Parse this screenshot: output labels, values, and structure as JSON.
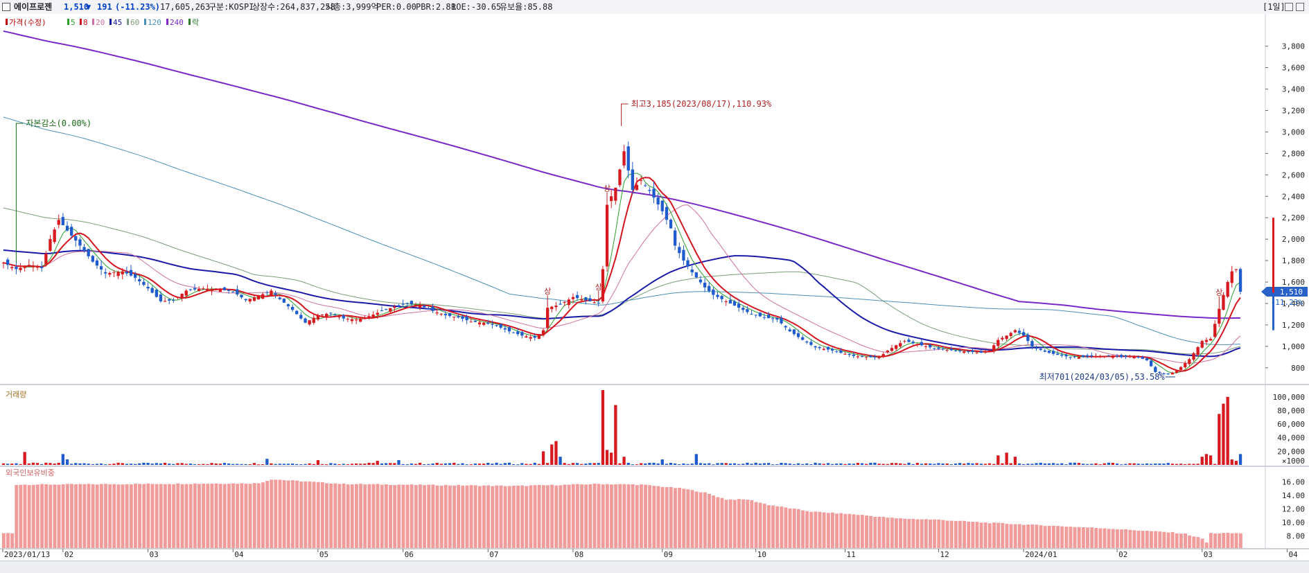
{
  "header": {
    "name": "에이프로젠",
    "price": "1,510",
    "change_arrow": "▼",
    "change": "191",
    "change_pct": "(-11.23%)",
    "volume": "17,605,263",
    "market": "구분:KOSPI",
    "listed": "상장수:264,837,258",
    "mcap": "시총:3,999억",
    "per": "PER:0.00",
    "pbr": "PBR:2.81",
    "roe": "ROE:-30.65",
    "float": "유보율:85.88",
    "period": "[1일]"
  },
  "legend": {
    "items": [
      {
        "label": "가격(수정)",
        "color": "#c00000"
      },
      {
        "label": "5",
        "color": "#2aa02a"
      },
      {
        "label": "8",
        "color": "#d4141e"
      },
      {
        "label": "20",
        "color": "#d070a0"
      },
      {
        "label": "45",
        "color": "#1a1aa8"
      },
      {
        "label": "60",
        "color": "#7a9e7a"
      },
      {
        "label": "120",
        "color": "#4a90b8"
      },
      {
        "label": "240",
        "color": "#7a28c8"
      },
      {
        "label": "락",
        "color": "#2a7a2a"
      }
    ],
    "volume_label": "거래량",
    "foreign_label": "외국인보유비중"
  },
  "annotations": {
    "capital_reduction": "자본감소(0.00%)",
    "high": "최고3,185(2023/08/17),110.93%",
    "low": "최저701(2024/03/05),53.58%",
    "limit_up": "상"
  },
  "current": {
    "price_label": "1,510",
    "pct_label": "-11.23%"
  },
  "chart_data": {
    "type": "candlestick",
    "x_labels": [
      "2023/01/13",
      "02",
      "03",
      "04",
      "05",
      "06",
      "07",
      "08",
      "09",
      "10",
      "11",
      "12",
      "2024/01",
      "02",
      "03",
      "04"
    ],
    "price_axis": {
      "ticks": [
        800,
        1000,
        1200,
        1400,
        1600,
        1800,
        2000,
        2200,
        2400,
        2600,
        2800,
        3000,
        3200,
        3400,
        3600,
        3800
      ],
      "ylim": [
        650,
        4050
      ]
    },
    "volume_axis": {
      "ticks": [
        "100,000",
        "80,000",
        "60,000",
        "40,000",
        "20,000"
      ],
      "unit": "×1000",
      "ylim": [
        0,
        110000
      ]
    },
    "foreign_axis": {
      "ticks": [
        "16.00",
        "14.00",
        "12.00",
        "10.00",
        "8.00"
      ],
      "ylim": [
        6.2,
        17.6
      ]
    },
    "price_anchors": [
      [
        0,
        1780
      ],
      [
        3,
        1720
      ],
      [
        6,
        1760
      ],
      [
        9,
        1730
      ],
      [
        11,
        2000
      ],
      [
        13,
        2180
      ],
      [
        15,
        2080
      ],
      [
        18,
        1940
      ],
      [
        21,
        1790
      ],
      [
        24,
        1680
      ],
      [
        28,
        1700
      ],
      [
        31,
        1640
      ],
      [
        34,
        1540
      ],
      [
        37,
        1420
      ],
      [
        40,
        1430
      ],
      [
        43,
        1520
      ],
      [
        47,
        1540
      ],
      [
        51,
        1530
      ],
      [
        54,
        1510
      ],
      [
        57,
        1430
      ],
      [
        60,
        1470
      ],
      [
        63,
        1520
      ],
      [
        65,
        1440
      ],
      [
        68,
        1340
      ],
      [
        71,
        1220
      ],
      [
        74,
        1290
      ],
      [
        77,
        1310
      ],
      [
        80,
        1260
      ],
      [
        83,
        1250
      ],
      [
        86,
        1280
      ],
      [
        89,
        1330
      ],
      [
        92,
        1370
      ],
      [
        95,
        1400
      ],
      [
        98,
        1380
      ],
      [
        101,
        1330
      ],
      [
        104,
        1290
      ],
      [
        107,
        1270
      ],
      [
        110,
        1230
      ],
      [
        113,
        1220
      ],
      [
        116,
        1190
      ],
      [
        119,
        1140
      ],
      [
        122,
        1100
      ],
      [
        125,
        1080
      ],
      [
        127,
        1150
      ],
      [
        128,
        1360
      ],
      [
        131,
        1390
      ],
      [
        134,
        1460
      ],
      [
        137,
        1430
      ],
      [
        140,
        1400
      ],
      [
        141,
        1720
      ],
      [
        142,
        2320
      ],
      [
        144,
        2480
      ],
      [
        146,
        2820
      ],
      [
        148,
        2460
      ],
      [
        150,
        2550
      ],
      [
        152,
        2450
      ],
      [
        155,
        2260
      ],
      [
        157,
        2100
      ],
      [
        158,
        1940
      ],
      [
        160,
        1800
      ],
      [
        162,
        1690
      ],
      [
        165,
        1550
      ],
      [
        167,
        1480
      ],
      [
        170,
        1420
      ],
      [
        173,
        1360
      ],
      [
        176,
        1300
      ],
      [
        179,
        1270
      ],
      [
        182,
        1250
      ],
      [
        185,
        1140
      ],
      [
        188,
        1060
      ],
      [
        191,
        990
      ],
      [
        194,
        970
      ],
      [
        197,
        940
      ],
      [
        200,
        910
      ],
      [
        203,
        900
      ],
      [
        206,
        895
      ],
      [
        208,
        960
      ],
      [
        210,
        1010
      ],
      [
        212,
        1050
      ],
      [
        215,
        1020
      ],
      [
        218,
        990
      ],
      [
        221,
        970
      ],
      [
        224,
        960
      ],
      [
        227,
        950
      ],
      [
        230,
        940
      ],
      [
        232,
        960
      ],
      [
        234,
        1060
      ],
      [
        236,
        1100
      ],
      [
        238,
        1150
      ],
      [
        240,
        1100
      ],
      [
        242,
        1000
      ],
      [
        245,
        950
      ],
      [
        248,
        920
      ],
      [
        251,
        900
      ],
      [
        254,
        900
      ],
      [
        257,
        910
      ],
      [
        260,
        910
      ],
      [
        263,
        900
      ],
      [
        266,
        910
      ],
      [
        269,
        870
      ],
      [
        271,
        760
      ],
      [
        274,
        740
      ],
      [
        276,
        770
      ],
      [
        279,
        880
      ],
      [
        282,
        1050
      ],
      [
        284,
        1070
      ],
      [
        286,
        1350
      ],
      [
        287,
        1480
      ],
      [
        288,
        1600
      ],
      [
        289,
        1700
      ],
      [
        290,
        1720
      ],
      [
        291,
        1510
      ]
    ],
    "volume_spikes": [
      [
        5,
        19
      ],
      [
        14,
        16
      ],
      [
        15,
        8
      ],
      [
        62,
        9
      ],
      [
        74,
        7
      ],
      [
        88,
        6
      ],
      [
        93,
        7
      ],
      [
        127,
        20
      ],
      [
        129,
        30
      ],
      [
        130,
        35
      ],
      [
        131,
        12
      ],
      [
        141,
        110
      ],
      [
        142,
        22
      ],
      [
        143,
        18
      ],
      [
        144,
        88
      ],
      [
        146,
        12
      ],
      [
        155,
        8
      ],
      [
        163,
        16
      ],
      [
        234,
        14
      ],
      [
        236,
        18
      ],
      [
        238,
        12
      ],
      [
        282,
        12
      ],
      [
        283,
        16
      ],
      [
        284,
        14
      ],
      [
        286,
        75
      ],
      [
        287,
        90
      ],
      [
        288,
        100
      ],
      [
        289,
        8
      ],
      [
        290,
        6
      ],
      [
        291,
        16
      ]
    ],
    "foreign_profile": [
      [
        0,
        8.4
      ],
      [
        2,
        8.4
      ],
      [
        3,
        15.6
      ],
      [
        60,
        15.8
      ],
      [
        63,
        16.4
      ],
      [
        80,
        15.7
      ],
      [
        120,
        15.4
      ],
      [
        140,
        15.7
      ],
      [
        150,
        15.6
      ],
      [
        160,
        15.0
      ],
      [
        165,
        14.4
      ],
      [
        170,
        13.4
      ],
      [
        175,
        13.4
      ],
      [
        180,
        12.6
      ],
      [
        190,
        11.6
      ],
      [
        200,
        11.2
      ],
      [
        210,
        10.6
      ],
      [
        220,
        10.4
      ],
      [
        230,
        10.0
      ],
      [
        240,
        9.7
      ],
      [
        250,
        9.4
      ],
      [
        260,
        9.1
      ],
      [
        270,
        8.7
      ],
      [
        275,
        8.5
      ],
      [
        278,
        8.3
      ],
      [
        282,
        7.6
      ],
      [
        283,
        7.0
      ],
      [
        284,
        8.4
      ],
      [
        291,
        8.4
      ]
    ],
    "n_bars": 292
  },
  "colors": {
    "up": "#d71920",
    "down": "#1e5bcc",
    "ma5": "#2aa02a",
    "ma8": "#d4141e",
    "ma20": "#d070a0",
    "ma45": "#1a1aa8",
    "ma60": "#7a9e7a",
    "ma120": "#4a90b8",
    "ma240": "#7a28c8",
    "foreign": "#f29b9b",
    "annotation": "#b22222",
    "reduction": "#1a6a1a"
  }
}
